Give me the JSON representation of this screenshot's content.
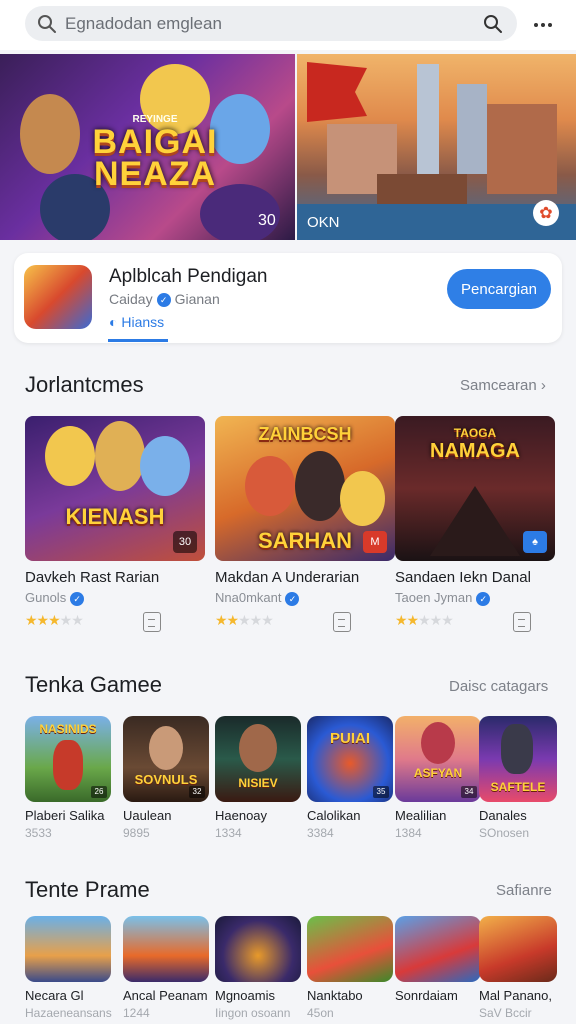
{
  "search": {
    "placeholder": "Egnadodan emglean"
  },
  "banners": [
    {
      "subtitle": "REYINGE",
      "title": "BAIGAI NEAZA",
      "tag": "30"
    },
    {
      "tag": "OKN"
    }
  ],
  "featured": {
    "name": "Aplblcah Pendigan",
    "developer": "Caiday",
    "developer_extra": "Gianan",
    "info": "Hianss",
    "button": "Pencargian"
  },
  "section1": {
    "title": "Jorlantcmes",
    "link": "Samcearan",
    "cards": [
      {
        "thumb_title": "KIENASH",
        "corner": "30",
        "name": "Davkeh Rast Rarian",
        "dev": "Gunols",
        "rating": 3
      },
      {
        "thumb_title": "SARHAN",
        "thumb_title2": "ZAINBCSH",
        "corner": "M",
        "name": "Makdan A Underarian",
        "dev": "Nna0mkant",
        "rating": 2
      },
      {
        "thumb_title": "NAMAGA",
        "thumb_title2": "TAOGA",
        "corner": "♠",
        "name": "Sandaen Iekn Danal",
        "dev": "Taoen Jyman",
        "rating": 2
      }
    ]
  },
  "section2": {
    "title": "Tenka Gamee",
    "link": "Daisc catagars",
    "tiles": [
      {
        "img": "NASINIDS",
        "corner": "26",
        "label": "Plaberi Salika",
        "count": "3533"
      },
      {
        "img": "SOVNULS",
        "corner": "32",
        "label": "Uaulean",
        "count": "9895"
      },
      {
        "img": "NISIEV",
        "corner": "",
        "label": "Haenoay",
        "count": "1334"
      },
      {
        "img": "PUIAI",
        "corner": "35",
        "label": "Calolikan",
        "count": "3384"
      },
      {
        "img": "ASFYAN",
        "corner": "34",
        "label": "Mealilian",
        "count": "1384"
      },
      {
        "img": "SAFTELE",
        "corner": "",
        "label": "Danales",
        "count": "SOnosen"
      }
    ]
  },
  "section3": {
    "title": "Tente Prame",
    "link": "Safianre",
    "tiles": [
      {
        "label": "Necara Gl",
        "count": "Hazaeneansans"
      },
      {
        "label": "Ancal Peanam",
        "count": "1244"
      },
      {
        "label": "Mgnoamis",
        "count": "Iingon osoann"
      },
      {
        "label": "Nanktabo",
        "count": "45on"
      },
      {
        "label": "Sonrdaiam",
        "count": ""
      },
      {
        "label": "Mal Panano,",
        "count": "SaV Bccir"
      }
    ]
  },
  "colors": {
    "accent": "#2f7fe6",
    "star": "#f5b82e"
  }
}
